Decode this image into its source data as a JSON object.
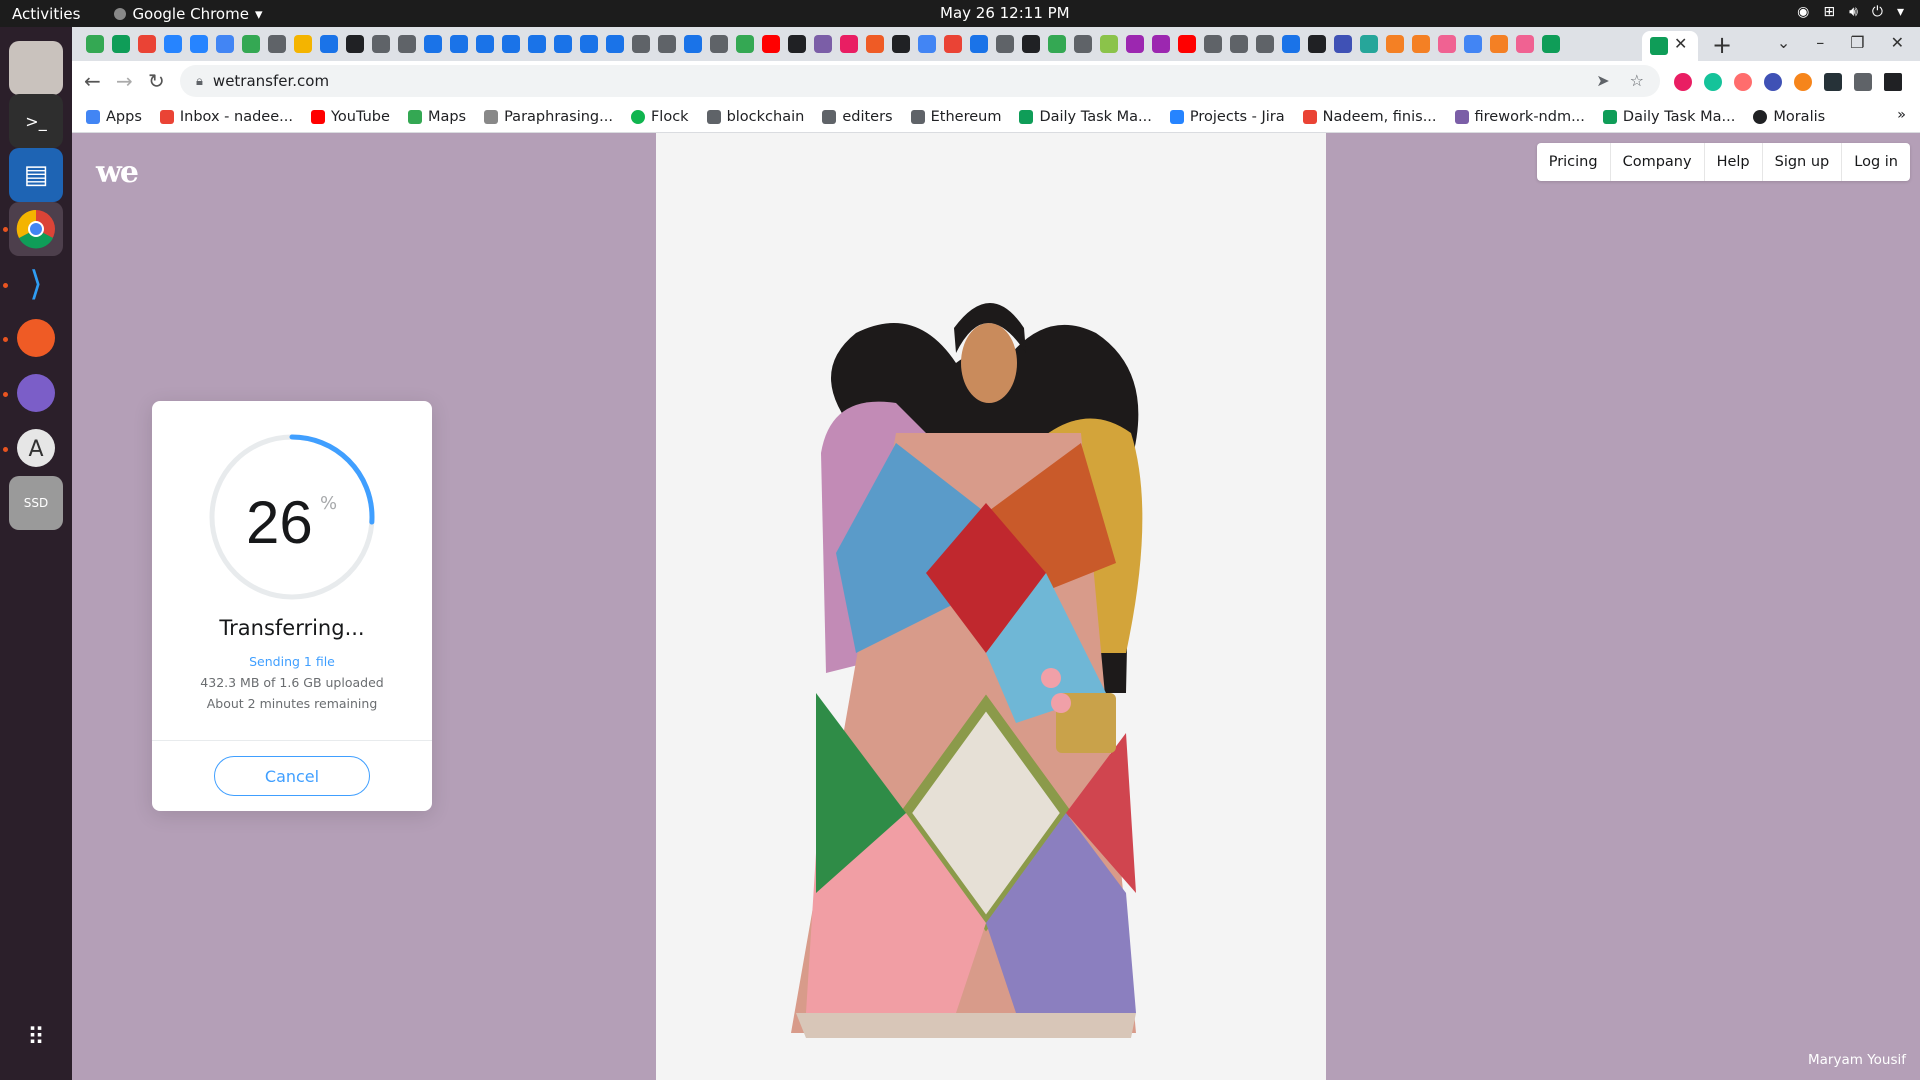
{
  "system": {
    "activities": "Activities",
    "app_name": "Google Chrome",
    "clock": "May 26  12:11 PM"
  },
  "browser": {
    "url": "wetransfer.com",
    "bookmarks": [
      {
        "label": "Apps",
        "color": "#4285f4"
      },
      {
        "label": "Inbox - nadee...",
        "color": "#ea4335"
      },
      {
        "label": "YouTube",
        "color": "#ff0000"
      },
      {
        "label": "Maps",
        "color": "#34a853"
      },
      {
        "label": "Paraphrasing...",
        "color": "#888888"
      },
      {
        "label": "Flock",
        "color": "#10b54f"
      },
      {
        "label": "blockchain",
        "color": "#5f6368"
      },
      {
        "label": "editers",
        "color": "#5f6368"
      },
      {
        "label": "Ethereum",
        "color": "#5f6368"
      },
      {
        "label": "Daily Task Ma...",
        "color": "#0f9d58"
      },
      {
        "label": "Projects - Jira",
        "color": "#2684ff"
      },
      {
        "label": "Nadeem, finis...",
        "color": "#ea4335"
      },
      {
        "label": "firework-ndm...",
        "color": "#7b5ea7"
      },
      {
        "label": "Daily Task Ma...",
        "color": "#0f9d58"
      },
      {
        "label": "Moralis",
        "color": "#202124"
      }
    ]
  },
  "wetransfer": {
    "logo": "we",
    "nav": [
      "Pricing",
      "Company",
      "Help",
      "Sign up",
      "Log in"
    ],
    "transfer": {
      "progress": 26,
      "percent_sign": "%",
      "status": "Transferring...",
      "sending": "Sending 1 file",
      "uploaded": "432.3 MB of 1.6 GB uploaded",
      "remaining": "About 2 minutes remaining",
      "cancel_label": "Cancel"
    },
    "artist_credit": "Maryam Yousif"
  },
  "colors": {
    "accent": "#409fff",
    "page_bg": "#b49fb7",
    "ring_track": "#e8ebed"
  }
}
